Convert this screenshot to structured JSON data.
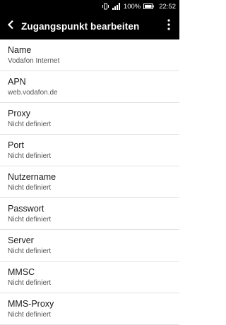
{
  "status_bar": {
    "battery_text": "100%",
    "time": "22:52",
    "icons": [
      "vibrate-icon",
      "signal-icon",
      "battery-icon"
    ]
  },
  "app_bar": {
    "title": "Zugangspunkt bearbeiten",
    "back_icon": "back-arrow-icon",
    "menu_icon": "overflow-menu-icon"
  },
  "settings": [
    {
      "label": "Name",
      "value": "Vodafon Internet"
    },
    {
      "label": "APN",
      "value": "web.vodafon.de"
    },
    {
      "label": "Proxy",
      "value": "Nicht definiert"
    },
    {
      "label": "Port",
      "value": "Nicht definiert"
    },
    {
      "label": "Nutzername",
      "value": "Nicht definiert"
    },
    {
      "label": "Passwort",
      "value": "Nicht definiert"
    },
    {
      "label": "Server",
      "value": "Nicht definiert"
    },
    {
      "label": "MMSC",
      "value": "Nicht definiert"
    },
    {
      "label": "MMS-Proxy",
      "value": "Nicht definiert"
    }
  ]
}
